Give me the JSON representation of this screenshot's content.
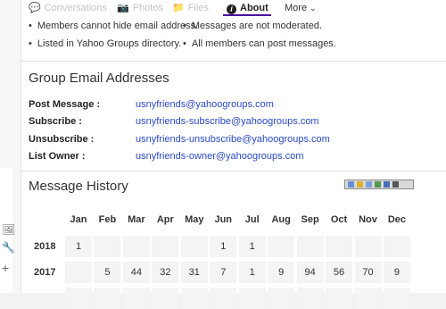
{
  "tabs": {
    "conversations": "Conversations",
    "photos": "Photos",
    "files": "Files",
    "about": "About",
    "more": "More"
  },
  "settings": {
    "col1": [
      "Members cannot hide email address.",
      "Listed in Yahoo Groups directory."
    ],
    "col2": [
      "Messages are not moderated.",
      "All members can post messages."
    ]
  },
  "group_email": {
    "heading": "Group Email Addresses",
    "rows": [
      {
        "label": "Post Message :",
        "email": "usnyfriends@yahoogroups.com"
      },
      {
        "label": "Subscribe :",
        "email": "usnyfriends-subscribe@yahoogroups.com"
      },
      {
        "label": "Unsubscribe :",
        "email": "usnyfriends-unsubscribe@yahoogroups.com"
      },
      {
        "label": "List Owner :",
        "email": "usnyfriends-owner@yahoogroups.com"
      }
    ]
  },
  "message_history": {
    "heading": "Message History",
    "months": [
      "Jan",
      "Feb",
      "Mar",
      "Apr",
      "May",
      "Jun",
      "Jul",
      "Aug",
      "Sep",
      "Oct",
      "Nov",
      "Dec"
    ],
    "years": [
      {
        "year": "2018",
        "values": [
          "1",
          "",
          "",
          "",
          "",
          "1",
          "1",
          "",
          "",
          "",
          "",
          ""
        ]
      },
      {
        "year": "2017",
        "values": [
          "",
          "5",
          "44",
          "32",
          "31",
          "7",
          "1",
          "9",
          "94",
          "56",
          "70",
          "9"
        ]
      },
      {
        "year": "",
        "values": [
          "",
          "",
          "",
          "",
          "",
          "",
          "",
          "",
          "",
          "",
          "",
          ""
        ]
      }
    ]
  },
  "colors": {
    "link": "#2a49c4",
    "active_underline": "#4b0aa0"
  },
  "icons": [
    "chat-icon",
    "camera-icon",
    "folder-icon",
    "info-icon",
    "chevron-down-icon",
    "images-icon",
    "wrench-icon",
    "plus-icon"
  ]
}
